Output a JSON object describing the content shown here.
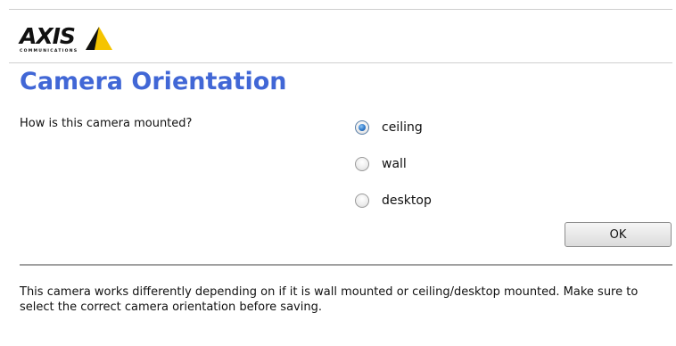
{
  "header": {
    "logo": {
      "wordmark": "AXIS",
      "subtitle": "COMMUNICATIONS",
      "colors": {
        "triangle": "#f5c400",
        "text": "#111111"
      }
    }
  },
  "title": "Camera Orientation",
  "form": {
    "question": "How is this camera mounted?",
    "options": [
      {
        "label": "ceiling",
        "selected": true
      },
      {
        "label": "wall",
        "selected": false
      },
      {
        "label": "desktop",
        "selected": false
      }
    ],
    "ok_label": "OK"
  },
  "note": "This camera works differently depending on if it is wall mounted or ceiling/desktop mounted. Make sure to select the correct camera orientation before saving.",
  "colors": {
    "title": "#4167d6",
    "radio_selected": "#2e78c9"
  }
}
